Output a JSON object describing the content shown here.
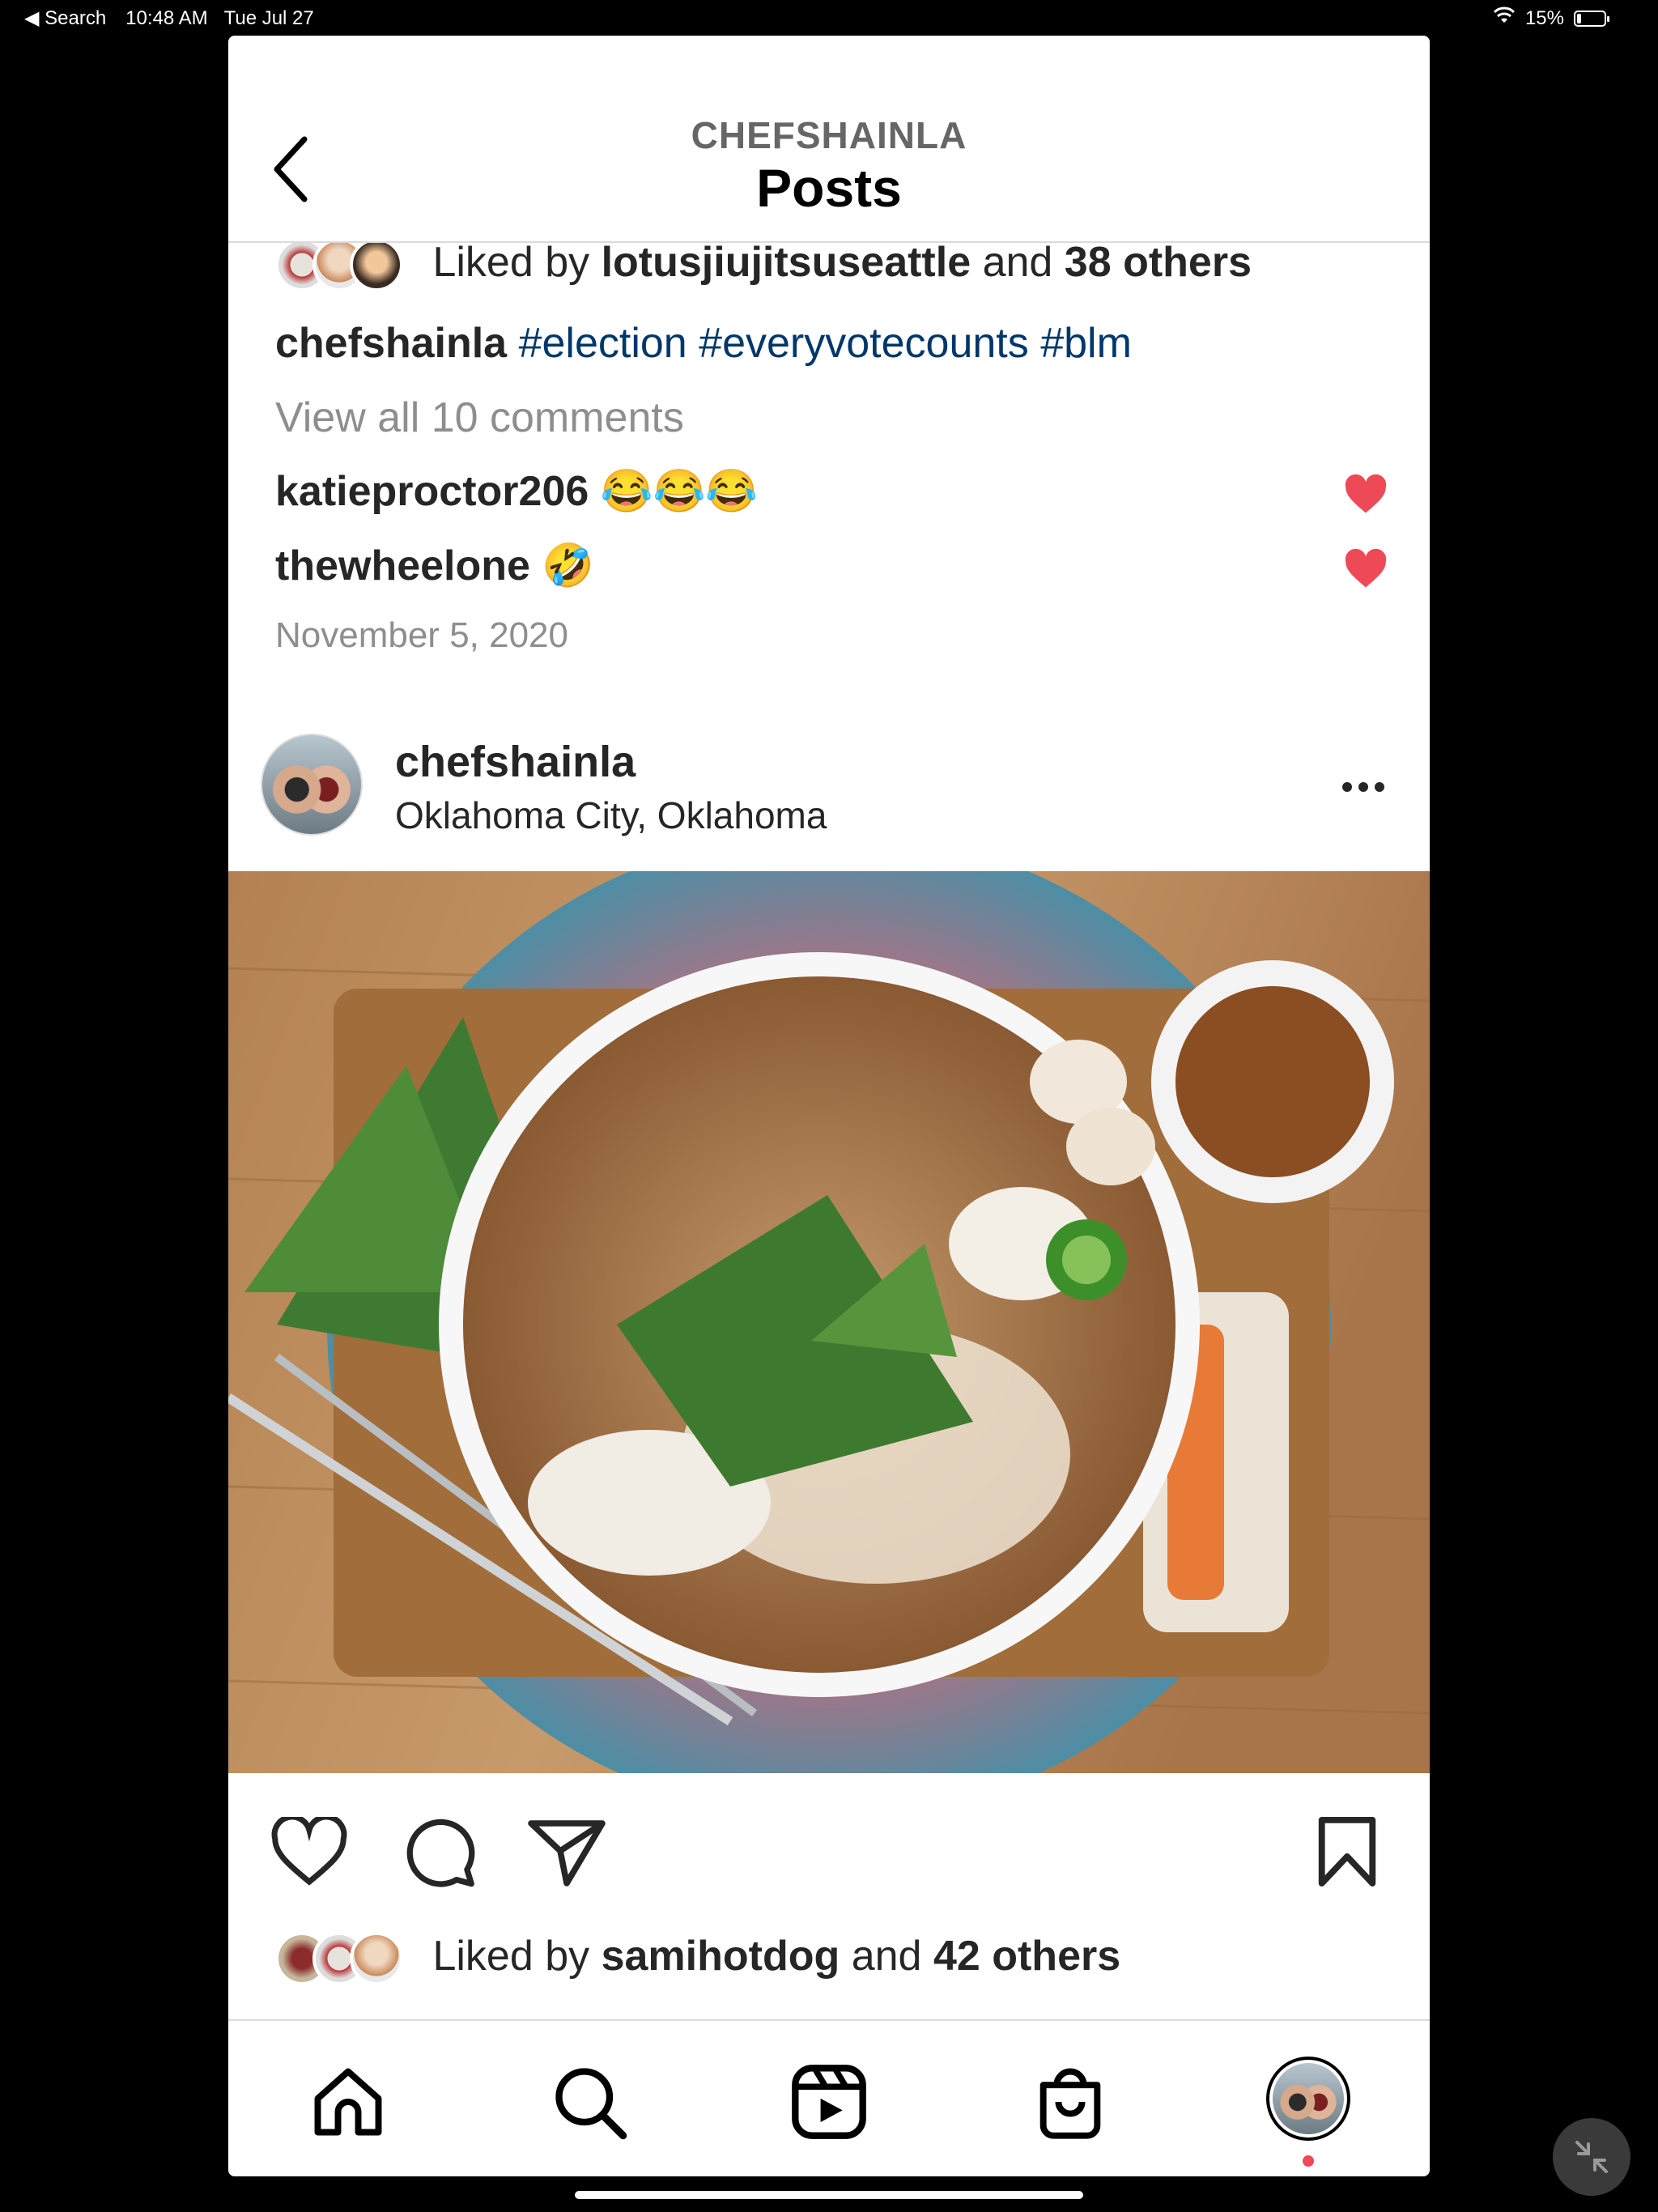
{
  "status_bar": {
    "back_app": "◀ Search",
    "time": "10:48 AM",
    "date": "Tue Jul 27",
    "battery": "15%",
    "battery_level": 0.15
  },
  "header": {
    "username": "CHEFSHAINLA",
    "title": "Posts",
    "back_icon": "chevron-left-icon"
  },
  "previous_post": {
    "likes_prefix": "Liked by",
    "liked_by_user": "lotusjiujitsuseattle",
    "likes_and": "and",
    "likes_others": "38 others",
    "caption_user": "chefshainla",
    "hashtags": [
      "#election",
      "#everyvotecounts",
      "#blm"
    ],
    "view_comments": "View all 10 comments",
    "comments": [
      {
        "user": "katieproctor206",
        "text": "😂😂😂"
      },
      {
        "user": "thewheelone",
        "text": "🤣"
      }
    ],
    "date": "November 5, 2020"
  },
  "post": {
    "username": "chefshainla",
    "location": "Oklahoma City, Oklahoma",
    "more_icon": "more-horizontal-icon",
    "likes_prefix": "Liked by",
    "liked_by_user": "samihotdog",
    "likes_and": "and",
    "likes_others": "42 others"
  },
  "colors": {
    "hashtag": "#00376b",
    "like_red": "#ed4956",
    "text": "#262626",
    "muted": "#8e8e8e"
  },
  "bottom_nav": [
    "home-icon",
    "search-icon",
    "reels-icon",
    "shop-icon",
    "profile-avatar"
  ]
}
